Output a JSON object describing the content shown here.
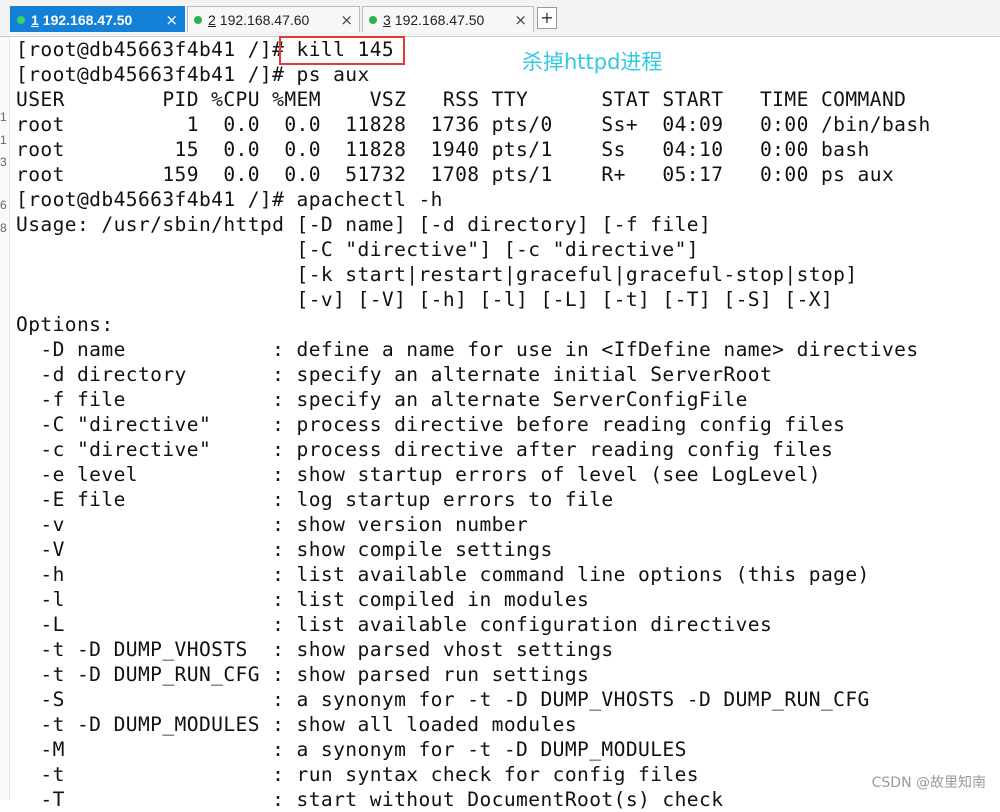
{
  "tabs": [
    {
      "num": "1",
      "host": "192.168.47.50",
      "close": "×"
    },
    {
      "num": "2",
      "host": "192.168.47.60",
      "close": "×"
    },
    {
      "num": "3",
      "host": "192.168.47.50",
      "close": "×"
    }
  ],
  "add_tab": "+",
  "gutter_marks": [
    "1",
    "1",
    "3",
    "6",
    "8"
  ],
  "terminal": {
    "lines": [
      "[root@db45663f4b41 /]# kill 145",
      "[root@db45663f4b41 /]# ps aux",
      "USER        PID %CPU %MEM    VSZ   RSS TTY      STAT START   TIME COMMAND",
      "root          1  0.0  0.0  11828  1736 pts/0    Ss+  04:09   0:00 /bin/bash",
      "root         15  0.0  0.0  11828  1940 pts/1    Ss   04:10   0:00 bash",
      "root        159  0.0  0.0  51732  1708 pts/1    R+   05:17   0:00 ps aux",
      "[root@db45663f4b41 /]# apachectl -h",
      "Usage: /usr/sbin/httpd [-D name] [-d directory] [-f file]",
      "                       [-C \"directive\"] [-c \"directive\"]",
      "                       [-k start|restart|graceful|graceful-stop|stop]",
      "                       [-v] [-V] [-h] [-l] [-L] [-t] [-T] [-S] [-X]",
      "Options:",
      "  -D name            : define a name for use in <IfDefine name> directives",
      "  -d directory       : specify an alternate initial ServerRoot",
      "  -f file            : specify an alternate ServerConfigFile",
      "  -C \"directive\"     : process directive before reading config files",
      "  -c \"directive\"     : process directive after reading config files",
      "  -e level           : show startup errors of level (see LogLevel)",
      "  -E file            : log startup errors to file",
      "  -v                 : show version number",
      "  -V                 : show compile settings",
      "  -h                 : list available command line options (this page)",
      "  -l                 : list compiled in modules",
      "  -L                 : list available configuration directives",
      "  -t -D DUMP_VHOSTS  : show parsed vhost settings",
      "  -t -D DUMP_RUN_CFG : show parsed run settings",
      "  -S                 : a synonym for -t -D DUMP_VHOSTS -D DUMP_RUN_CFG",
      "  -t -D DUMP_MODULES : show all loaded modules",
      "  -M                 : a synonym for -t -D DUMP_MODULES",
      "  -t                 : run syntax check for config files",
      "  -T                 : start without DocumentRoot(s) check"
    ]
  },
  "annotation": "杀掉httpd进程",
  "watermark": "CSDN @故里知南",
  "colors": {
    "active_tab": "#1580d8",
    "status_dot": "#2bb24c",
    "highlight_box": "#e53935",
    "annotation": "#31c8e8"
  }
}
